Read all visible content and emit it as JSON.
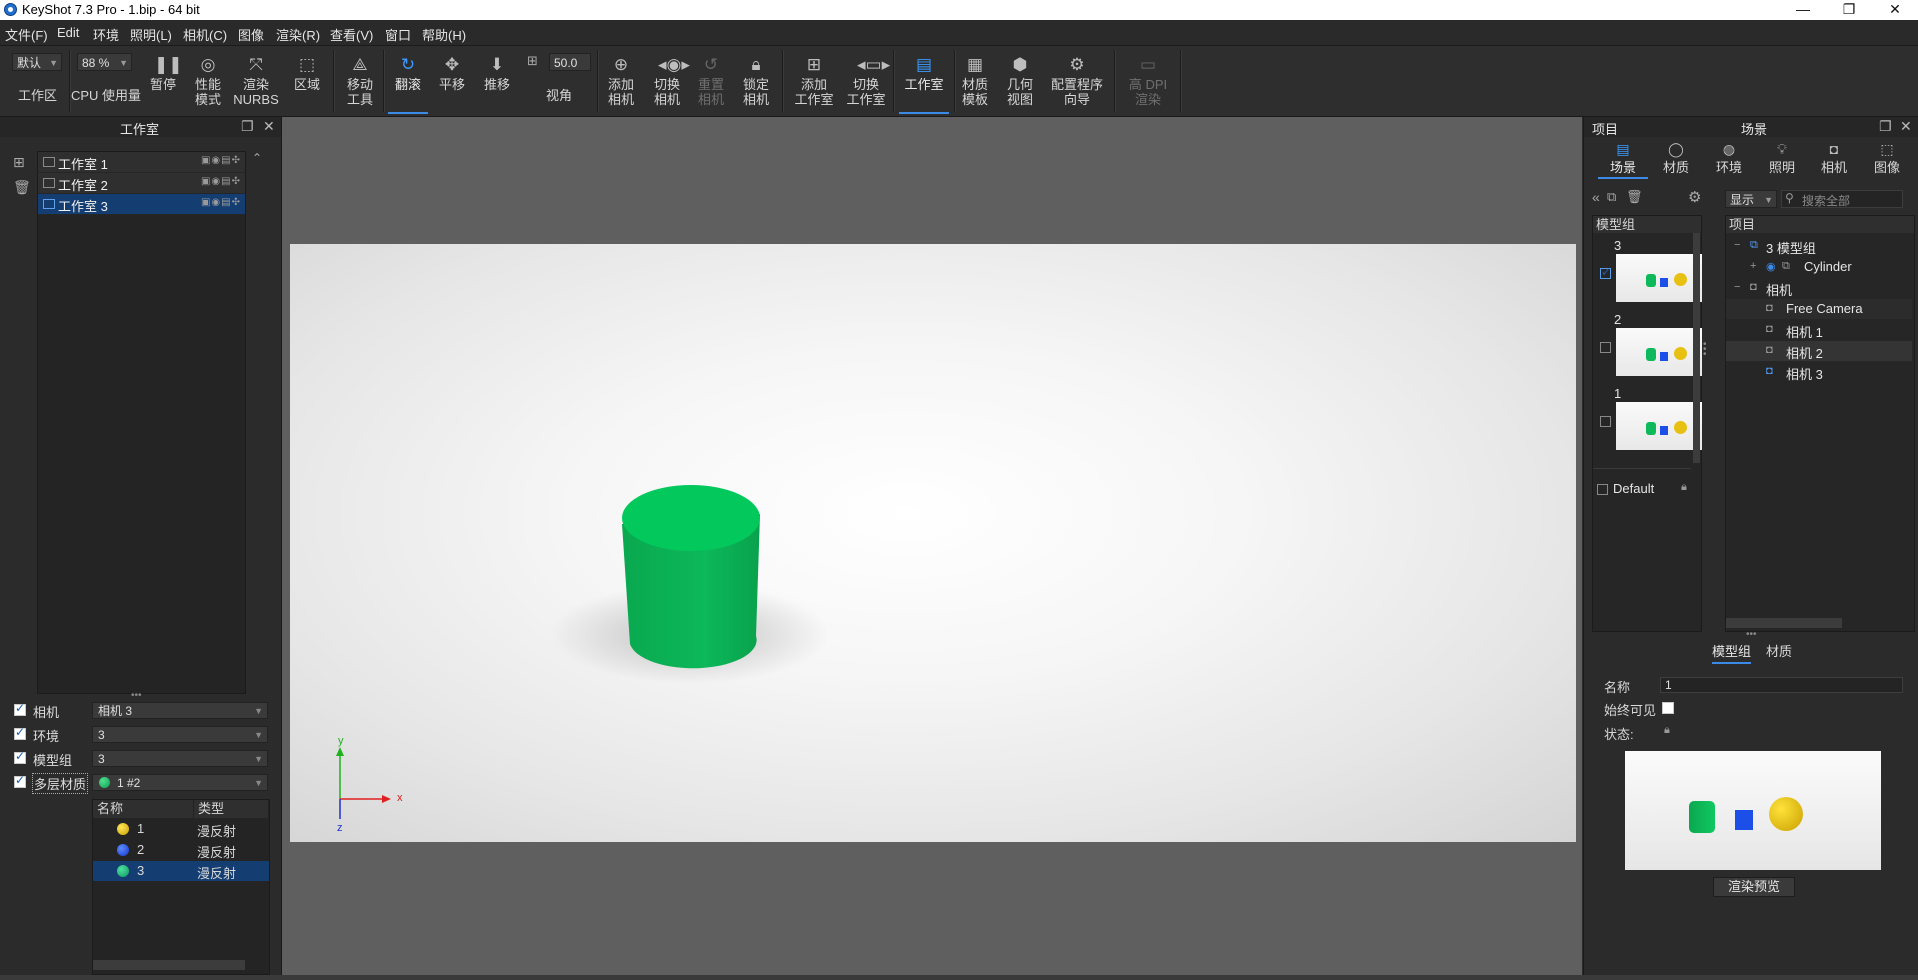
{
  "window": {
    "title": "KeyShot 7.3 Pro  - 1.bip  - 64 bit",
    "controls": [
      "—",
      "❐",
      "✕"
    ]
  },
  "menu": [
    "文件(F)",
    "Edit",
    "环境",
    "照明(L)",
    "相机(C)",
    "图像",
    "渲染(R)",
    "查看(V)",
    "窗口",
    "帮助(H)"
  ],
  "toolbar": {
    "workspace_combo": "默认",
    "workspace_label": "工作区",
    "cpu_combo": "88 %",
    "cpu_label": "CPU 使用量",
    "pause": "暂停",
    "perf_mode": [
      "性能",
      "模式"
    ],
    "render_nurbs": [
      "渲染",
      "NURBS"
    ],
    "region": "区域",
    "move_tool": [
      "移动",
      "工具"
    ],
    "tumble": "翻滚",
    "pan": "平移",
    "dolly": "推移",
    "fov_value": "50.0",
    "fov_label": "视角",
    "add_camera": [
      "添加",
      "相机"
    ],
    "switch_camera": [
      "切换",
      "相机"
    ],
    "reset_camera": [
      "重置",
      "相机"
    ],
    "lock_camera": [
      "锁定",
      "相机"
    ],
    "add_studio": [
      "添加",
      "工作室"
    ],
    "switch_studio": [
      "切换",
      "工作室"
    ],
    "studio": "工作室",
    "material_template": [
      "材质",
      "模板"
    ],
    "geometry_view": [
      "几何",
      "视图"
    ],
    "config_wizard": [
      "配置程序",
      "向导"
    ],
    "high_dpi": [
      "高 DPI",
      "渲染"
    ]
  },
  "studio_panel": {
    "title": "工作室",
    "studios": [
      {
        "label": "工作室 1",
        "selected": false
      },
      {
        "label": "工作室 2",
        "selected": false
      },
      {
        "label": "工作室 3",
        "selected": true
      }
    ],
    "props": [
      {
        "label": "相机",
        "value": "相机 3"
      },
      {
        "label": "环境",
        "value": "3"
      },
      {
        "label": "模型组",
        "value": "3"
      },
      {
        "label": "多层材质",
        "value": "1  #2"
      }
    ],
    "table_headers": [
      "名称",
      "类型"
    ],
    "materials": [
      {
        "name": "1",
        "type": "漫反射",
        "color": "#e6c21a",
        "selected": false
      },
      {
        "name": "2",
        "type": "漫反射",
        "color": "#1e55e6",
        "selected": false
      },
      {
        "name": "3",
        "type": "漫反射",
        "color": "#12b06a",
        "selected": true
      }
    ]
  },
  "viewport": {
    "axis_labels": {
      "x": "x",
      "y": "y",
      "z": "z"
    }
  },
  "scene_panel": {
    "left_title": "项目",
    "title": "场景",
    "tabs": [
      {
        "label": "场景",
        "icon": "scene-icon",
        "active": true
      },
      {
        "label": "材质",
        "icon": "material-icon",
        "active": false
      },
      {
        "label": "环境",
        "icon": "environment-icon",
        "active": false
      },
      {
        "label": "照明",
        "icon": "lighting-icon",
        "active": false
      },
      {
        "label": "相机",
        "icon": "camera-icon",
        "active": false
      },
      {
        "label": "图像",
        "icon": "image-icon",
        "active": false
      }
    ],
    "display_combo": "显示",
    "search_placeholder": "搜索全部",
    "model_groups_header": "模型组",
    "model_groups": [
      {
        "label": "3",
        "checked": true
      },
      {
        "label": "2",
        "checked": false
      },
      {
        "label": "1",
        "checked": false
      }
    ],
    "default_group": "Default",
    "tree_header": "项目",
    "tree": [
      {
        "label": "3 模型组",
        "level": 0,
        "toggle": "−"
      },
      {
        "label": "Cylinder",
        "level": 1,
        "toggle": "+"
      },
      {
        "label": "相机",
        "level": 0,
        "toggle": "−"
      },
      {
        "label": "Free Camera",
        "level": 1,
        "toggle": ""
      },
      {
        "label": "相机 1",
        "level": 1,
        "toggle": ""
      },
      {
        "label": "相机 2",
        "level": 1,
        "toggle": ""
      },
      {
        "label": "相机 3",
        "level": 1,
        "toggle": ""
      }
    ],
    "sub_tabs": [
      {
        "label": "模型组",
        "active": true
      },
      {
        "label": "材质",
        "active": false
      }
    ],
    "name_label": "名称",
    "name_value": "1",
    "always_visible_label": "始终可见",
    "status_label": "状态:",
    "render_preview_button": "渲染预览"
  }
}
